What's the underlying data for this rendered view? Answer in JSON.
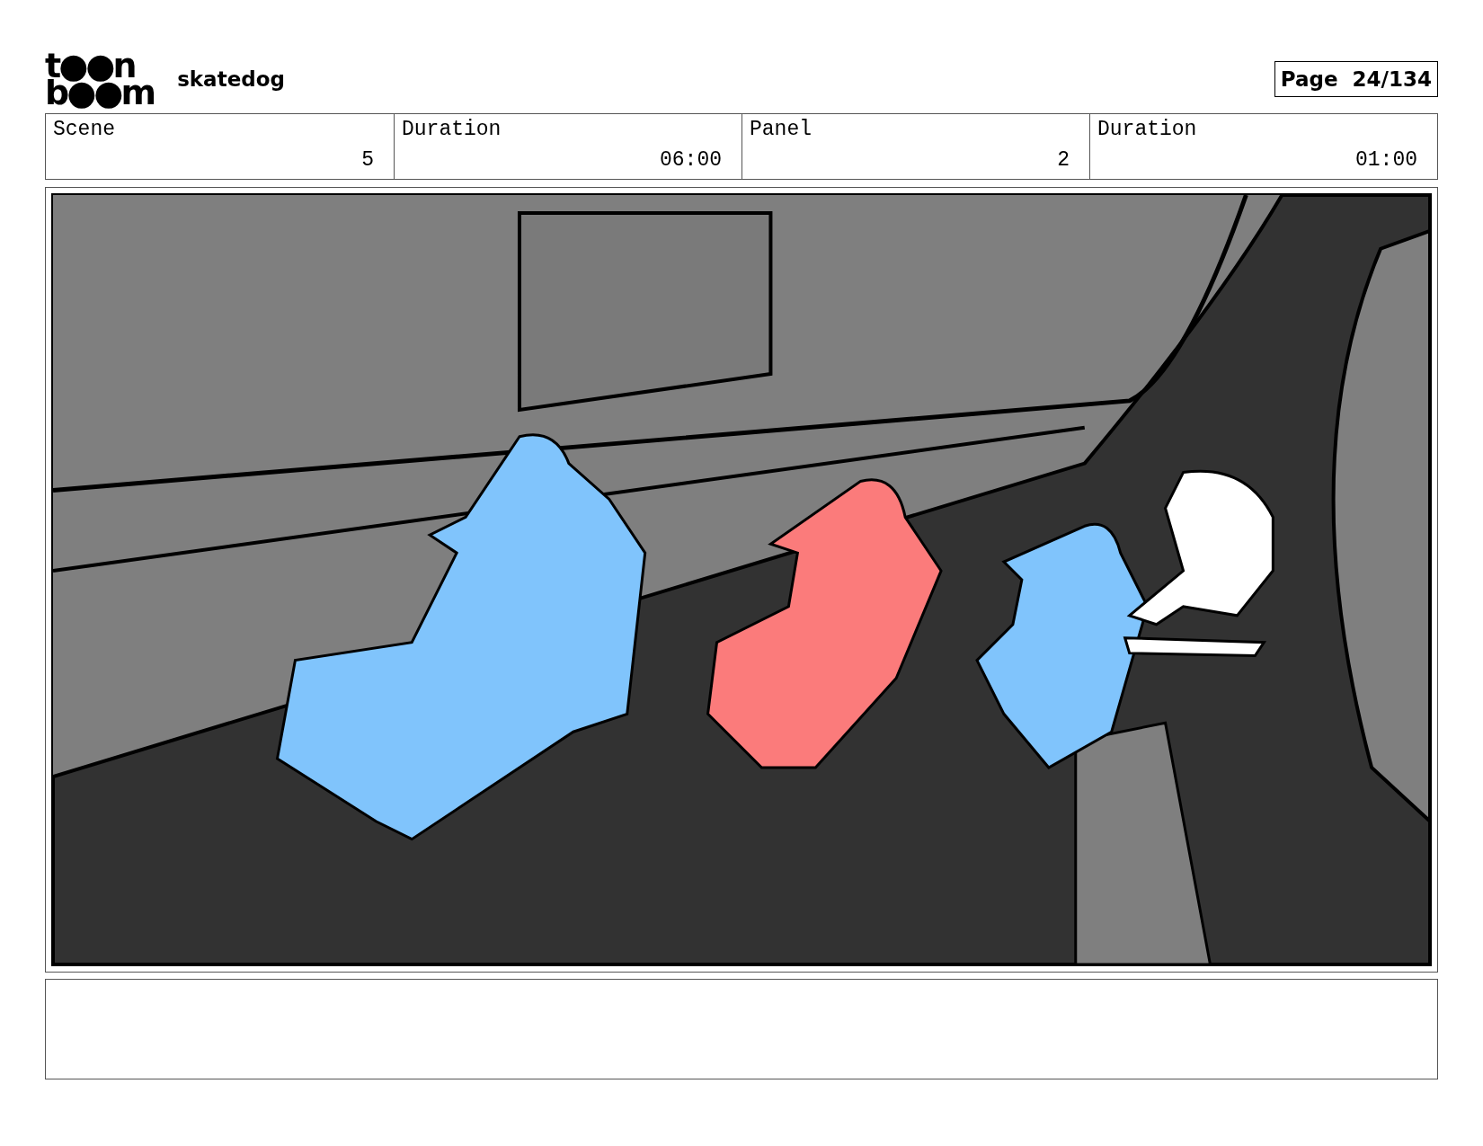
{
  "logo": [
    "t●●n",
    "b●●m"
  ],
  "project": "skatedog",
  "page": {
    "label": "Page",
    "value": "24/134"
  },
  "fields": [
    {
      "label": "Scene",
      "value": "5"
    },
    {
      "label": "Duration",
      "value": "06:00"
    },
    {
      "label": "Panel",
      "value": "2"
    },
    {
      "label": "Duration",
      "value": "01:00"
    }
  ]
}
